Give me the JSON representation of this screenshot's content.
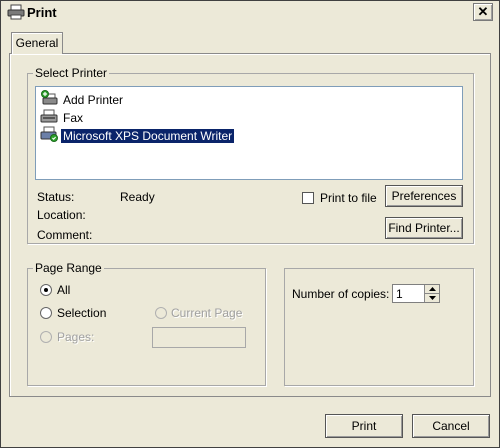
{
  "window": {
    "title": "Print",
    "close_glyph": "✕"
  },
  "tabs": [
    {
      "label": "General",
      "active": true
    }
  ],
  "select_printer": {
    "legend": "Select Printer",
    "printers": [
      {
        "name": "Add Printer",
        "icon": "add-printer-icon",
        "selected": false
      },
      {
        "name": "Fax",
        "icon": "fax-icon",
        "selected": false
      },
      {
        "name": "Microsoft XPS Document Writer",
        "icon": "printer-icon",
        "selected": true
      }
    ],
    "status_label": "Status:",
    "status_value": "Ready",
    "location_label": "Location:",
    "comment_label": "Comment:",
    "print_to_file_label": "Print to file",
    "print_to_file_checked": false,
    "preferences_button": "Preferences",
    "find_printer_button": "Find Printer..."
  },
  "page_range": {
    "legend": "Page Range",
    "all_label": "All",
    "selection_label": "Selection",
    "current_page_label": "Current Page",
    "pages_label": "Pages:",
    "pages_value": "",
    "selected_option": "All"
  },
  "copies": {
    "label": "Number of copies:",
    "value": "1"
  },
  "footer": {
    "print_button": "Print",
    "cancel_button": "Cancel"
  },
  "colors": {
    "selection_bg": "#0a246a",
    "window_bg": "#ece9d8"
  }
}
